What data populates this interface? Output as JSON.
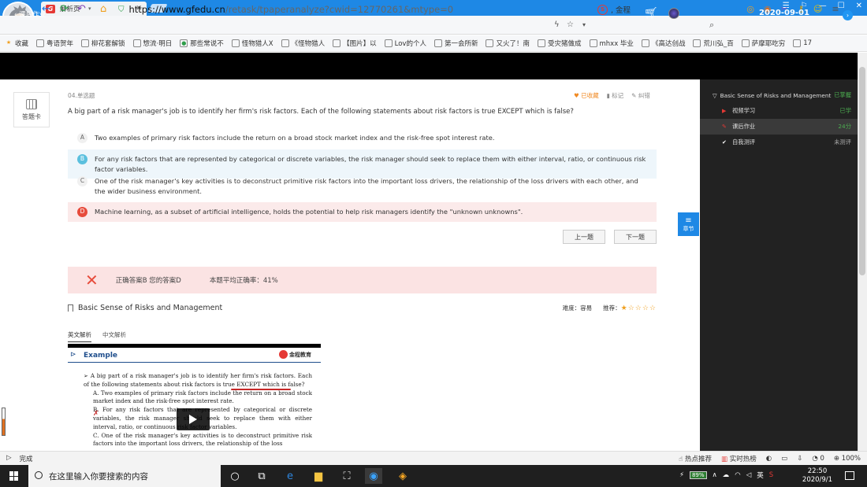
{
  "browser": {
    "tab_title": "解析页",
    "url_host": "https://www.gfedu.cn",
    "url_path": "/retask/tpaperanalyze?cwid=12770261&mtype=0",
    "search_text": ", 金程",
    "bookmarks": [
      "收藏",
      "粤语贺年",
      "柳花套解锁",
      "惣流·明日",
      "那些常说不",
      "怪物猎人X",
      "《怪物猎人",
      "【图片】以",
      "Lov的个人",
      "第一会所新",
      "又火了！南",
      "受灾猪做成",
      "mhxx 毕业",
      "《高达创战",
      "荒川弘_百",
      "萨摩耶吃穷",
      "17"
    ]
  },
  "header": {
    "back_label": "课后作业",
    "date": "2020-09-01"
  },
  "card_button_label": "答题卡",
  "question": {
    "type_label": "04.单选题",
    "actions": {
      "favorite": "已收藏",
      "mark": "标记",
      "report": "纠错"
    },
    "text": "A big part of a risk manager's job is to identify her firm's risk factors. Each of the following statements about risk factors is true EXCEPT which is false?",
    "options": [
      {
        "letter": "A",
        "text": "Two examples of primary risk factors include the return on a broad stock market index and the risk-free spot interest rate."
      },
      {
        "letter": "B",
        "text": "For any risk factors that are represented by categorical or discrete variables, the risk manager should seek to replace them with either interval, ratio, or continuous risk factor variables."
      },
      {
        "letter": "C",
        "text": "One of the risk manager's key activities is to deconstruct primitive risk factors into the important loss drivers, the relationship of the loss drivers with each other, and the wider business environment."
      },
      {
        "letter": "D",
        "text": "Machine learning, as a subset of artificial intelligence, holds the potential to help risk managers identify the \"unknown unknowns\"."
      }
    ],
    "prev_label": "上一题",
    "next_label": "下一题"
  },
  "result": {
    "icon": "✕",
    "answers_text": "正确答案B 您的答案D",
    "avg_text": "本题平均正确率：41%"
  },
  "topic": {
    "title": "Basic Sense of Risks and  Management",
    "difficulty": "难度：容易",
    "recommend_label": "推荐：",
    "stars": "★☆☆☆☆",
    "rating": 1
  },
  "analysis_tabs": [
    "英文解析",
    "中文解析"
  ],
  "video": {
    "slide_title": "Example",
    "logo_text": "金程教育",
    "stem": "A big part of a risk manager's job is to identify her firm's risk factors. Each of the following statements about risk factors is true EXCEPT which is false?",
    "opt_a": "A.  Two examples of primary risk factors include the return on a broad stock market index and the risk-free spot interest rate.",
    "opt_b": "B.  For any risk factors that are represented by categorical or discrete variables, the risk manager should seek to replace them with either interval, ratio, or continuous risk factor variables.",
    "opt_c": "C.  One of the risk manager's key activities is to deconstruct primitive risk factors into the important loss drivers, the relationship of the loss"
  },
  "sidebar": {
    "chapter_tab": "章节",
    "section": {
      "title": "Basic Sense of Risks and Management",
      "status": "已掌握"
    },
    "items": [
      {
        "label": "视频学习",
        "status": "已学"
      },
      {
        "label": "课后作业",
        "status": "24分"
      },
      {
        "label": "自我测评",
        "status": "未测评"
      }
    ]
  },
  "statusbar": {
    "status": "完成",
    "hot": "热点推荐",
    "live": "实时热榜",
    "count": "0",
    "zoom": "100%"
  },
  "taskbar": {
    "search_placeholder": "在这里输入你要搜索的内容",
    "battery": "89%",
    "ime": "英",
    "time": "22:50",
    "date": "2020/9/1"
  },
  "colors": {
    "accent": "#1e88e5",
    "correct": "#5bc0de",
    "wrong": "#e74c3c",
    "favorite": "#f08a24"
  }
}
